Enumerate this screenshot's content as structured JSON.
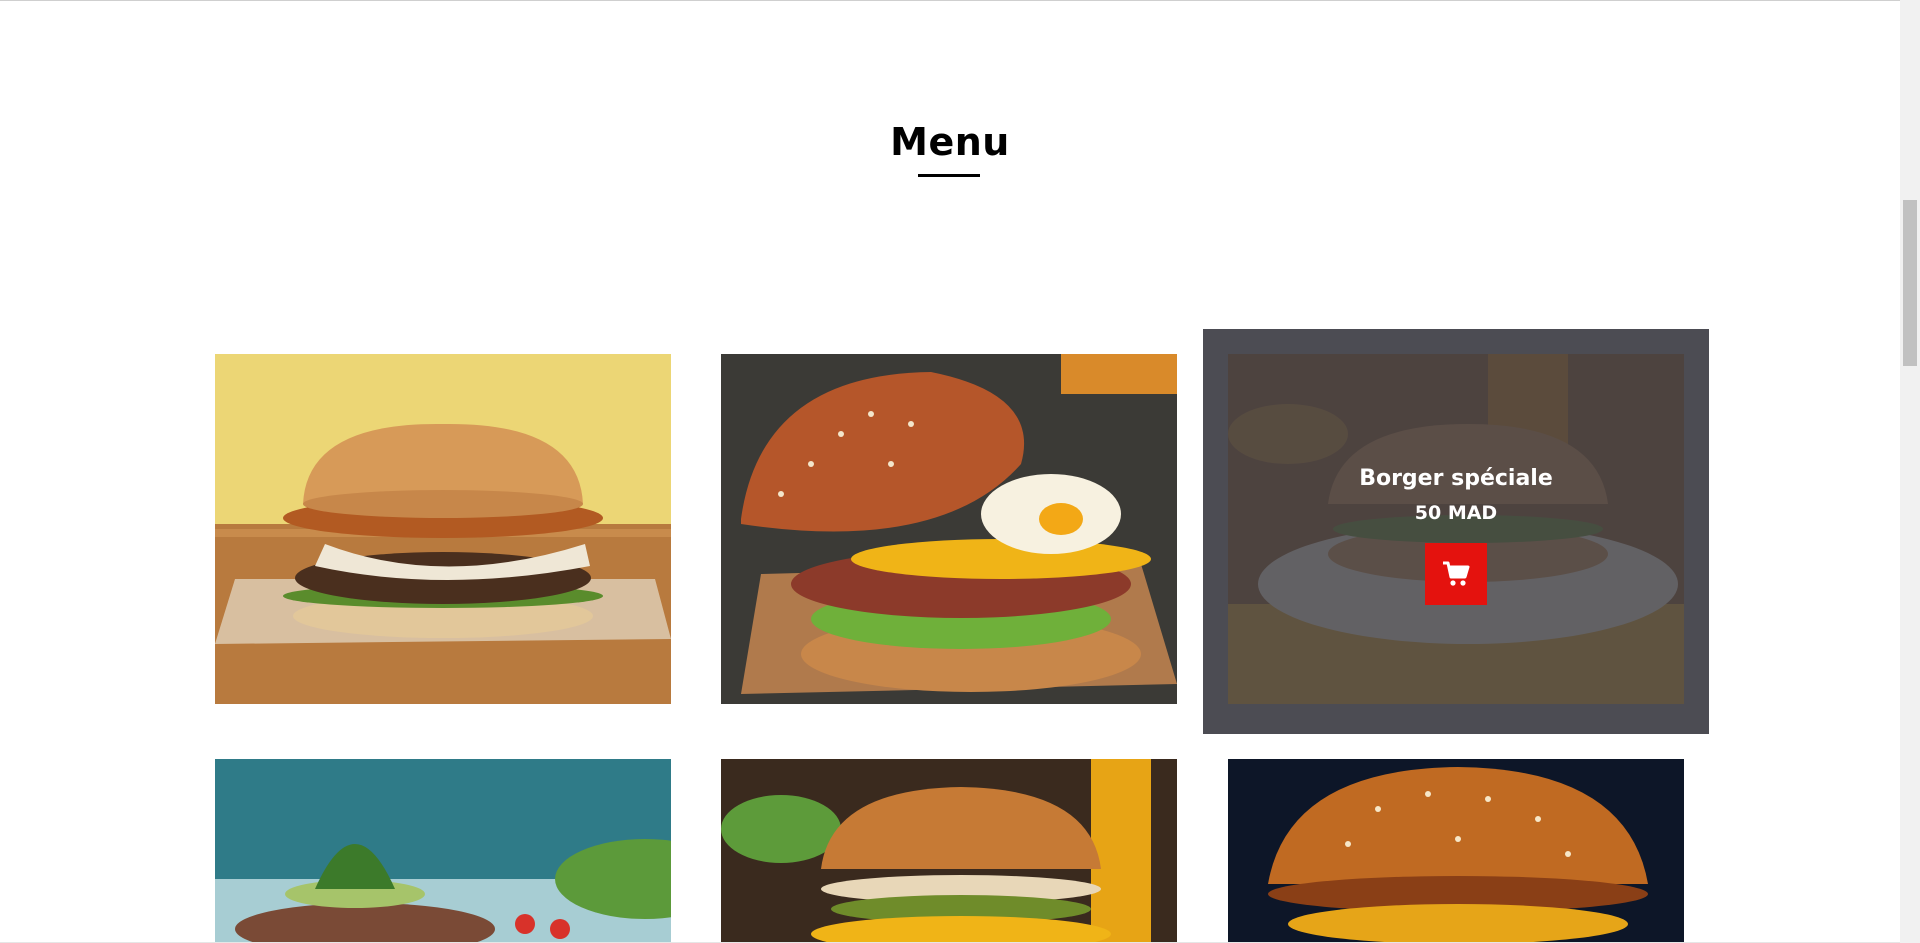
{
  "section": {
    "title": "Menu"
  },
  "menu_items": [
    {
      "name": "burger-1",
      "background": "#e8cf6d"
    },
    {
      "name": "burger-2",
      "background": "#34332f"
    },
    {
      "name": "Borger spéciale",
      "price": "50 MAD",
      "background": "#7c4a24",
      "overlay_color": "#3c3c42",
      "cart_icon": "shopping-cart-icon",
      "button_color": "#e4120e"
    },
    {
      "name": "burger-4",
      "background": "#2e7a86"
    },
    {
      "name": "burger-5",
      "background": "#3a2a1e"
    },
    {
      "name": "burger-6",
      "background": "#0c1426"
    }
  ]
}
